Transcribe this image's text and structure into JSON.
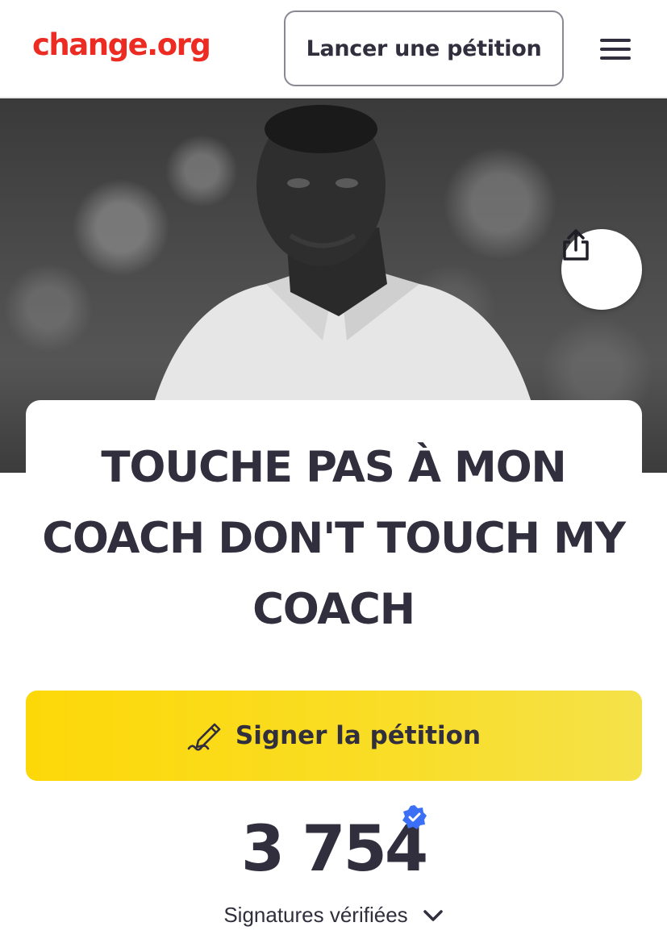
{
  "header": {
    "logo_text": "change.org",
    "start_petition_label": "Lancer une pétition",
    "menu_icon": "hamburger-menu-icon"
  },
  "hero": {
    "image_description_icon": "coach-photo",
    "share_icon": "share-icon"
  },
  "petition": {
    "title": "TOUCHE PAS À MON COACH DON'T TOUCH MY COACH",
    "sign_label": "Signer la pétition",
    "sign_icon": "pen-signature-icon",
    "signature_count": "3 754",
    "verified_icon": "verified-badge-icon",
    "signatures_label": "Signatures vérifiées",
    "expand_icon": "chevron-down-icon"
  },
  "colors": {
    "brand": "#ec2c22",
    "sign_button": "#fdd808",
    "text": "#312e3d",
    "verified": "#3b6ff5"
  }
}
